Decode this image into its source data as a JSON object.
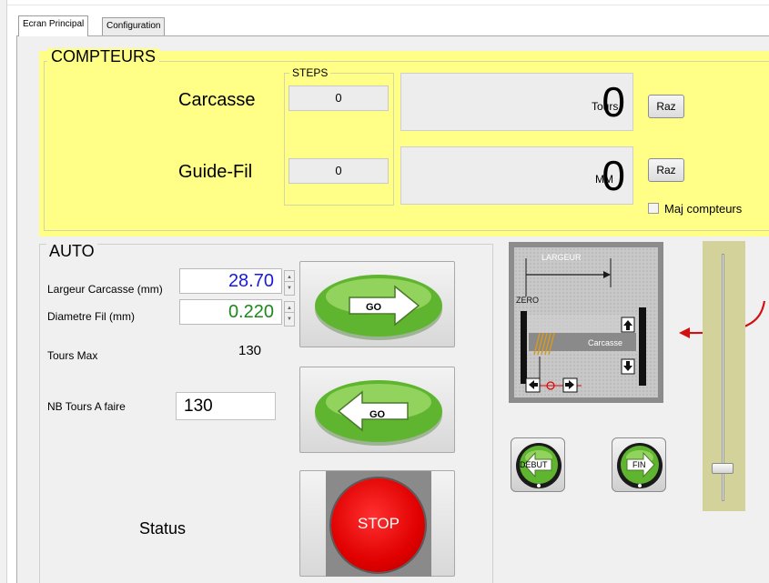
{
  "tabs": [
    "Ecran Principal",
    "Configuration"
  ],
  "counters": {
    "title": "COMPTEURS",
    "steps_legend": "STEPS",
    "rows": [
      {
        "label": "Carcasse",
        "steps": "0",
        "value": "0",
        "unit": "Tours",
        "reset": "Raz"
      },
      {
        "label": "Guide-Fil",
        "steps": "0",
        "value": "0",
        "unit": "MM",
        "reset": "Raz"
      }
    ],
    "update_checkbox": {
      "label": "Maj compteurs",
      "checked": false
    }
  },
  "auto": {
    "title": "AUTO",
    "largeur_label": "Largeur Carcasse (mm)",
    "largeur_value": "28.70",
    "diametre_label": "Diametre Fil (mm)",
    "diametre_value": "0.220",
    "tours_max_label": "Tours Max",
    "tours_max_value": "130",
    "nb_tours_label": "NB Tours A faire",
    "nb_tours_value": "130",
    "go_forward": "GO",
    "go_back": "GO",
    "stop": "STOP",
    "status_label": "Status"
  },
  "diagram": {
    "largeur": "LARGEUR",
    "zero": "ZERO",
    "carcasse": "Carcasse"
  },
  "nav": {
    "debut": "DEBUT",
    "fin": "FIN"
  },
  "slider": {
    "level": 0.1
  },
  "colors": {
    "panel_yellow": "#ffff88",
    "value_blue": "#1a1adc",
    "value_green": "#1a8a1a",
    "stop_red": "#e00000",
    "go_green": "#58b030",
    "arrow_red": "#d21010"
  }
}
